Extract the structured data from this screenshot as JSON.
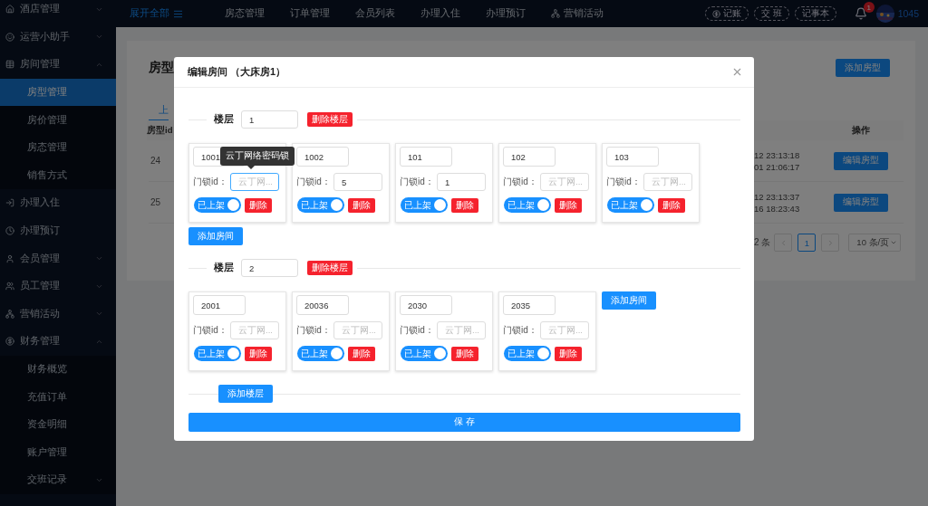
{
  "sidebar": {
    "items": [
      {
        "label": "酒店管理",
        "selected": false,
        "expanded": false
      },
      {
        "label": "运营小助手",
        "selected": false,
        "expanded": false
      },
      {
        "label": "房间管理",
        "selected": false,
        "expanded": true,
        "children": [
          {
            "label": "房型管理",
            "selected": true
          },
          {
            "label": "房价管理",
            "selected": false
          },
          {
            "label": "房态管理",
            "selected": false
          },
          {
            "label": "销售方式",
            "selected": false
          }
        ]
      },
      {
        "label": "办理入住",
        "selected": false
      },
      {
        "label": "办理预订",
        "selected": false
      },
      {
        "label": "会员管理",
        "selected": false,
        "expanded": false
      },
      {
        "label": "员工管理",
        "selected": false,
        "expanded": false
      },
      {
        "label": "营销活动",
        "selected": false,
        "expanded": false
      },
      {
        "label": "财务管理",
        "selected": false,
        "expanded": true,
        "children": [
          {
            "label": "财务概览",
            "selected": false
          },
          {
            "label": "充值订单",
            "selected": false
          },
          {
            "label": "资金明细",
            "selected": false
          },
          {
            "label": "账户管理",
            "selected": false
          },
          {
            "label": "交班记录",
            "selected": false,
            "expanded": false
          }
        ]
      }
    ]
  },
  "topbar": {
    "expand_all": "展开全部",
    "nav": [
      "房态管理",
      "订单管理",
      "会员列表",
      "办理入住",
      "办理预订",
      "营销活动"
    ],
    "actions": [
      "记账",
      "交 班",
      "记事本"
    ],
    "notifications": "1",
    "user": "1045"
  },
  "page": {
    "title": "房型",
    "add_button": "添加房型",
    "tabs": [
      {
        "label": "上",
        "selected": true
      }
    ],
    "columns": [
      "房型id",
      "操作"
    ],
    "rows": [
      {
        "id": "24",
        "times": [
          "12 23:13:18",
          "01 21:06:17"
        ],
        "action": "编辑房型"
      },
      {
        "id": "25",
        "times": [
          "12 23:13:37",
          "16 18:23:43"
        ],
        "action": "编辑房型"
      }
    ],
    "pagination": {
      "total": "2 条",
      "pages": [
        {
          "label": "1",
          "selected": true
        }
      ],
      "page_size": "10 条/页"
    }
  },
  "dialog": {
    "title": "编辑房间 （大床房1）",
    "floors": [
      {
        "label": "楼层",
        "value": "1",
        "delete": "删除楼层",
        "add_room": "添加房间",
        "rooms": [
          {
            "number": "1001",
            "lock_label": "门锁id：",
            "lock_placeholder": "云丁网...",
            "focused": true,
            "tooltip": "云丁网络密码锁",
            "listed": true,
            "listed_label": "已上架",
            "delete": "删除"
          },
          {
            "number": "1002",
            "lock_label": "门锁id：",
            "lock_value": "5",
            "focused": false,
            "listed": true,
            "listed_label": "已上架",
            "delete": "删除"
          },
          {
            "number": "101",
            "lock_label": "门锁id：",
            "lock_value": "1",
            "focused": false,
            "listed": true,
            "listed_label": "已上架",
            "delete": "删除"
          },
          {
            "number": "102",
            "lock_label": "门锁id：",
            "lock_placeholder": "云丁网...",
            "focused": false,
            "listed": true,
            "listed_label": "已上架",
            "delete": "删除"
          },
          {
            "number": "103",
            "lock_label": "门锁id：",
            "lock_placeholder": "云丁网...",
            "focused": false,
            "listed": true,
            "listed_label": "已上架",
            "delete": "删除"
          }
        ]
      },
      {
        "label": "楼层",
        "value": "2",
        "delete": "删除楼层",
        "add_room": "添加房间",
        "rooms": [
          {
            "number": "2001",
            "lock_label": "门锁id：",
            "lock_placeholder": "云丁网...",
            "focused": false,
            "listed": true,
            "listed_label": "已上架",
            "delete": "删除"
          },
          {
            "number": "20036",
            "lock_label": "门锁id：",
            "lock_placeholder": "云丁网...",
            "focused": false,
            "listed": true,
            "listed_label": "已上架",
            "delete": "删除"
          },
          {
            "number": "2030",
            "lock_label": "门锁id：",
            "lock_placeholder": "云丁网...",
            "focused": false,
            "listed": true,
            "listed_label": "已上架",
            "delete": "删除"
          },
          {
            "number": "2035",
            "lock_label": "门锁id：",
            "lock_placeholder": "云丁网...",
            "focused": false,
            "listed": true,
            "listed_label": "已上架",
            "delete": "删除"
          }
        ]
      }
    ],
    "add_floor": "添加楼层",
    "save": "保 存"
  }
}
